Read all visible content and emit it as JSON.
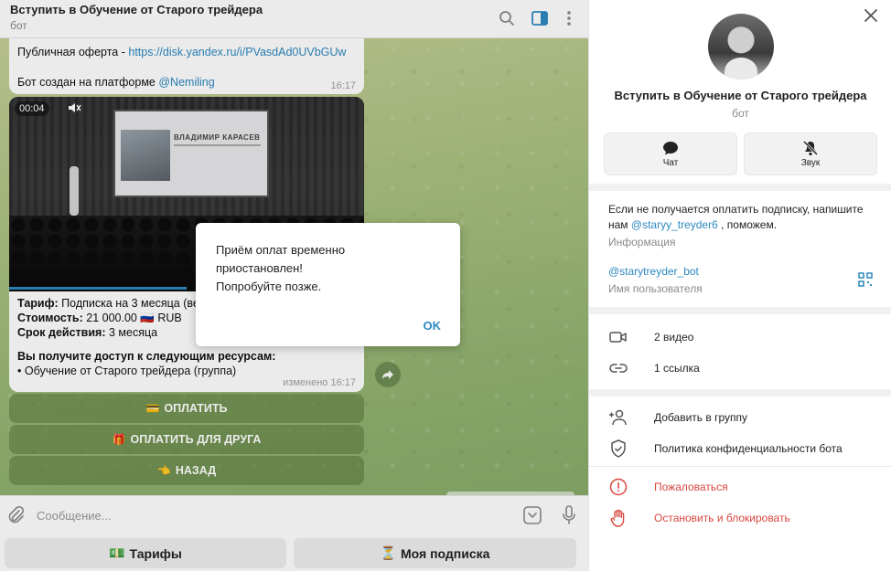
{
  "chat": {
    "title": "Вступить в Обучение от Старого трейдера",
    "subtitle": "бот",
    "messages": {
      "offer_prefix": "Публичная оферта - ",
      "offer_link": "https://disk.yandex.ru/i/PVasdAd0UVbGUw",
      "platform_prefix": "Бот создан на платформе ",
      "platform_link": "@Nemiling",
      "first_time": "16:17",
      "video_time": "00:04",
      "video_screen_name": "ВЛАДИМИР КАРАСЕВ",
      "tariff_label": "Тариф:",
      "tariff_value": " Подписка на 3 месяца (вес",
      "cost_label": "Стоимость:",
      "cost_value": " 21 000.00 🇷🇺 RUB",
      "term_label": "Срок действия:",
      "term_value": " 3 месяца",
      "access_heading": "Вы получите доступ к следующим ресурсам:",
      "access_item": "• Обучение от Старого трейдера (группа)",
      "edited_time": "изменено 16:17"
    },
    "inline_buttons": [
      {
        "emoji": "💳",
        "label": "ОПЛАТИТЬ"
      },
      {
        "emoji": "🎁",
        "label": "ОПЛАТИТЬ ДЛЯ ДРУГА"
      },
      {
        "emoji": "👈",
        "label": "НАЗАД"
      }
    ],
    "composer": {
      "placeholder": "Сообщение..."
    },
    "reply_keyboard": [
      {
        "emoji": "💵",
        "label": "Тарифы"
      },
      {
        "emoji": "⏳",
        "label": "Моя подписка"
      }
    ]
  },
  "dialog": {
    "lines": [
      "Приём оплат временно",
      "приостановлен!",
      "Попробуйте позже."
    ],
    "ok_label": "OK"
  },
  "profile": {
    "name": "Вступить в Обучение от Старого трейдера",
    "type": "бот",
    "actions": [
      {
        "label": "Чат"
      },
      {
        "label": "Звук"
      }
    ],
    "info_prefix": "Если не получается оплатить подписку, напишите нам ",
    "info_link": "@staryy_treyder6",
    "info_suffix": " , поможем.",
    "info_label": "Информация",
    "username": "@starytreyder_bot",
    "username_label": "Имя пользователя",
    "media_rows": [
      {
        "label": "2 видео"
      },
      {
        "label": "1 ссылка"
      }
    ],
    "action_rows": [
      {
        "label": "Добавить в группу"
      },
      {
        "label": "Политика конфиденциальности бота"
      }
    ],
    "danger_rows": [
      {
        "label": "Пожаловаться"
      },
      {
        "label": "Остановить и блокировать"
      }
    ]
  },
  "colors": {
    "accent": "#2d88c0",
    "danger": "#d9473f"
  }
}
